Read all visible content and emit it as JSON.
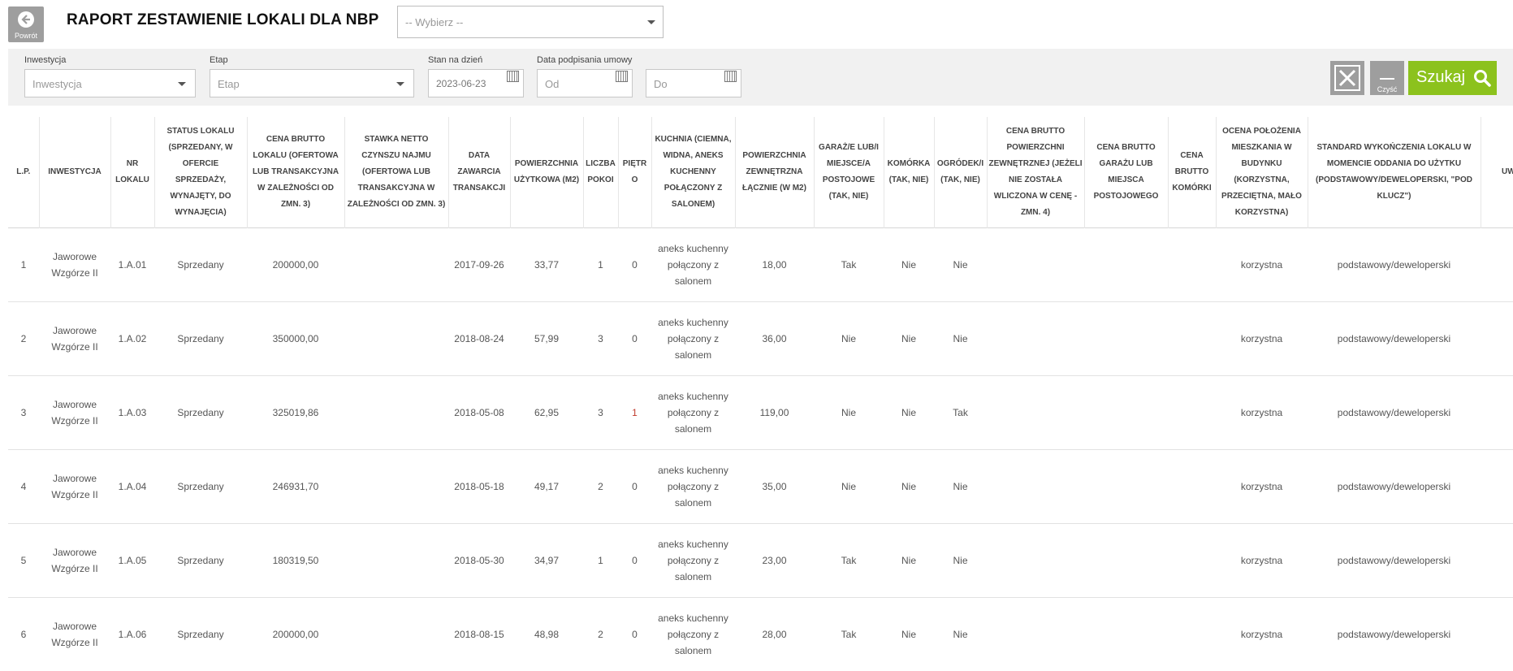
{
  "header": {
    "back_label": "Powrót",
    "title": "RAPORT ZESTAWIENIE LOKALI DLA NBP",
    "select_value": "-- Wybierz --"
  },
  "filters": {
    "investment_label": "Inwestycja",
    "investment_placeholder": "Inwestycja",
    "stage_label": "Etap",
    "stage_placeholder": "Etap",
    "date_label": "Stan na dzień",
    "date_value": "2023-06-23",
    "signing_label": "Data podpisania umowy",
    "from_placeholder": "Od",
    "to_placeholder": "Do",
    "clear_label": "Czyść",
    "search_label": "Szukaj"
  },
  "table": {
    "columns": [
      "L.P.",
      "INWESTYCJA",
      "NR LOKALU",
      "STATUS LOKALU (SPRZEDANY, W OFERCIE SPRZEDAŻY, WYNAJĘTY, DO WYNAJĘCIA)",
      "CENA BRUTTO LOKALU (OFERTOWA LUB TRANSAKCYJNA W ZALEŻNOŚCI OD ZMN. 3)",
      "STAWKA NETTO CZYNSZU NAJMU (OFERTOWA LUB TRANSAKCYJNA W ZALEŻNOŚCI OD ZMN. 3)",
      "DATA ZAWARCIA TRANSAKCJI",
      "POWIERZCHNIA UŻYTKOWA (M2)",
      "LICZBA POKOI",
      "PIĘTRO",
      "KUCHNIA (CIEMNA, WIDNA, ANEKS KUCHENNY POŁĄCZONY Z SALONEM)",
      "POWIERZCHNIA ZEWNĘTRZNA ŁĄCZNIE (W M2)",
      "GARAŻ/E LUB/I MIEJSCE/A POSTOJOWE (TAK, NIE)",
      "KOMÓRKA (TAK, NIE)",
      "OGRÓDEK/I (TAK, NIE)",
      "CENA BRUTTO POWIERZCHNI ZEWNĘTRZNEJ (JEŻELI NIE ZOSTAŁA WLICZONA W CENĘ - ZMN. 4)",
      "CENA BRUTTO GARAŻU LUB MIEJSCA POSTOJOWEGO",
      "CENA BRUTTO KOMÓRKI",
      "OCENA POŁOŻENIA MIESZKANIA W BUDYNKU (KORZYSTNA, PRZECIĘTNA, MAŁO KORZYSTNA)",
      "STANDARD WYKOŃCZENIA LOKALU W MOMENCIE ODDANIA DO UŻYTKU (PODSTAWOWY/DEWELOPERSKI, \"POD KLUCZ\")",
      "UWAGI"
    ],
    "rows": [
      [
        "1",
        "Jaworowe Wzgórze II",
        "1.A.01",
        "Sprzedany",
        "200000,00",
        "",
        "2017-09-26",
        "33,77",
        "1",
        "0",
        "aneks kuchenny połączony z salonem",
        "18,00",
        "Tak",
        "Nie",
        "Nie",
        "",
        "",
        "",
        "korzystna",
        "podstawowy/deweloperski",
        ""
      ],
      [
        "2",
        "Jaworowe Wzgórze II",
        "1.A.02",
        "Sprzedany",
        "350000,00",
        "",
        "2018-08-24",
        "57,99",
        "3",
        "0",
        "aneks kuchenny połączony z salonem",
        "36,00",
        "Nie",
        "Nie",
        "Nie",
        "",
        "",
        "",
        "korzystna",
        "podstawowy/deweloperski",
        ""
      ],
      [
        "3",
        "Jaworowe Wzgórze II",
        "1.A.03",
        "Sprzedany",
        "325019,86",
        "",
        "2018-05-08",
        "62,95",
        "3",
        "1",
        "aneks kuchenny połączony z salonem",
        "119,00",
        "Nie",
        "Nie",
        "Tak",
        "",
        "",
        "",
        "korzystna",
        "podstawowy/deweloperski",
        ""
      ],
      [
        "4",
        "Jaworowe Wzgórze II",
        "1.A.04",
        "Sprzedany",
        "246931,70",
        "",
        "2018-05-18",
        "49,17",
        "2",
        "0",
        "aneks kuchenny połączony z salonem",
        "35,00",
        "Nie",
        "Nie",
        "Nie",
        "",
        "",
        "",
        "korzystna",
        "podstawowy/deweloperski",
        ""
      ],
      [
        "5",
        "Jaworowe Wzgórze II",
        "1.A.05",
        "Sprzedany",
        "180319,50",
        "",
        "2018-05-30",
        "34,97",
        "1",
        "0",
        "aneks kuchenny połączony z salonem",
        "23,00",
        "Tak",
        "Nie",
        "Nie",
        "",
        "",
        "",
        "korzystna",
        "podstawowy/deweloperski",
        ""
      ],
      [
        "6",
        "Jaworowe Wzgórze II",
        "1.A.06",
        "Sprzedany",
        "200000,00",
        "",
        "2018-08-15",
        "48,98",
        "2",
        "0",
        "aneks kuchenny połączony z salonem",
        "28,00",
        "Tak",
        "Nie",
        "Nie",
        "",
        "",
        "",
        "korzystna",
        "podstawowy/deweloperski",
        ""
      ]
    ]
  },
  "colors": {
    "accent_green": "#8cc21d",
    "button_gray": "#9e9e9e",
    "highlight_red": "#c0392b"
  }
}
